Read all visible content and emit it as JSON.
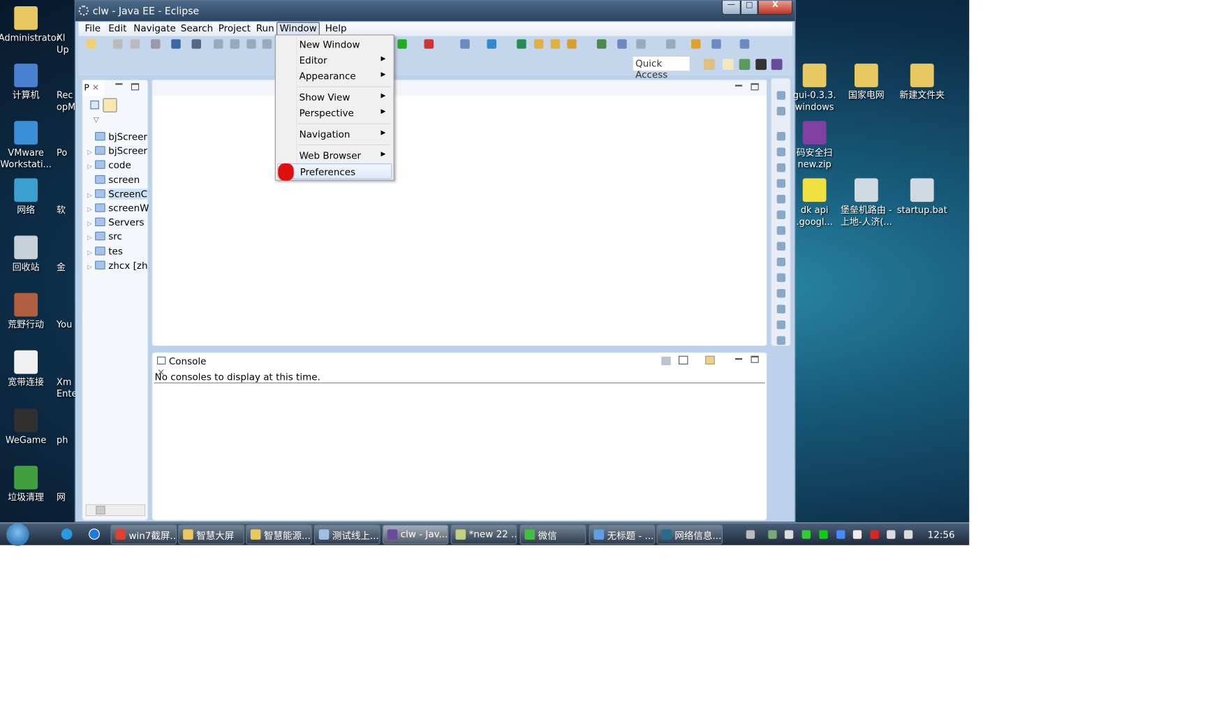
{
  "desktop": {
    "left_icons": [
      {
        "label": "Administrator",
        "color": "#e8c860"
      },
      {
        "label": "计算机",
        "color": "#4a80d0"
      },
      {
        "label": "VMware Workstati...",
        "color": "#3a8fd8"
      },
      {
        "label": "网络",
        "color": "#3aa0d0"
      },
      {
        "label": "回收站",
        "color": "#c8d0d8"
      },
      {
        "label": "荒野行动",
        "color": "#b06040"
      },
      {
        "label": "宽带连接",
        "color": "#f0f0f0"
      },
      {
        "label": "WeGame",
        "color": "#303030"
      },
      {
        "label": "垃圾清理",
        "color": "#40a040"
      }
    ],
    "second_column": [
      "Xl Up",
      "Rec opM",
      "Po",
      "软",
      "金",
      "You",
      "Xm Ente",
      "ph",
      "网"
    ],
    "right_icons": [
      {
        "label": "gui-0.3.3. windows",
        "color": "#e8c860"
      },
      {
        "label": "国家电网",
        "color": "#e8c860"
      },
      {
        "label": "新建文件夹",
        "color": "#e8c860"
      },
      {
        "label": "码安全扫 new.zip",
        "color": "#8040a0"
      },
      {
        "label": "dk api .googl...",
        "color": "#f0e040"
      },
      {
        "label": "堡垒机路由 - 上地-人济(...",
        "color": "#d0d8e0"
      },
      {
        "label": "startup.bat",
        "color": "#d0d8e0"
      }
    ]
  },
  "window": {
    "title": "clw - Java EE - Eclipse",
    "controls": {
      "minimize": "—",
      "maximize": "□",
      "close": "X"
    },
    "menubar": [
      "File",
      "Edit",
      "Navigate",
      "Search",
      "Project",
      "Run",
      "Window",
      "Help"
    ],
    "open_menu": "Window",
    "quick_access": "Quick Access",
    "project_explorer": {
      "tab_label": "P",
      "items": [
        {
          "label": "bjScreer",
          "expandable": false
        },
        {
          "label": "bjScreer",
          "expandable": true
        },
        {
          "label": "code",
          "expandable": true
        },
        {
          "label": "screen",
          "expandable": false
        },
        {
          "label": "ScreenC",
          "expandable": true,
          "selected": true
        },
        {
          "label": "screenW",
          "expandable": true
        },
        {
          "label": "Servers",
          "expandable": true
        },
        {
          "label": "src",
          "expandable": true
        },
        {
          "label": "tes",
          "expandable": true
        },
        {
          "label": "zhcx [zh",
          "expandable": true
        }
      ]
    },
    "console": {
      "tab_label": "Console",
      "message": "No consoles to display at this time."
    }
  },
  "window_menu": {
    "items": [
      {
        "label": "New Window",
        "submenu": false
      },
      {
        "label": "Editor",
        "submenu": true
      },
      {
        "label": "Appearance",
        "submenu": true,
        "sep_after": true
      },
      {
        "label": "Show View",
        "submenu": true
      },
      {
        "label": "Perspective",
        "submenu": true,
        "sep_after": true
      },
      {
        "label": "Navigation",
        "submenu": true,
        "sep_after": true
      },
      {
        "label": "Web Browser",
        "submenu": true
      },
      {
        "label": "Preferences",
        "submenu": false,
        "highlighted": true
      }
    ]
  },
  "taskbar": {
    "buttons": [
      {
        "label": "win7截屏...",
        "color": "#e04030"
      },
      {
        "label": "智慧大屏",
        "color": "#e8c860"
      },
      {
        "label": "智慧能源...",
        "color": "#e8c860"
      },
      {
        "label": "测试线上...",
        "color": "#a0c0e0"
      },
      {
        "label": "clw - Jav...",
        "color": "#6a4a9a",
        "active": true
      },
      {
        "label": "*new 22 ...",
        "color": "#c0d080"
      },
      {
        "label": "微信",
        "color": "#40c040"
      },
      {
        "label": "无标题 - ...",
        "color": "#60a0e0"
      },
      {
        "label": "网络信息...",
        "color": "#2a6a8a"
      }
    ],
    "clock": "12:56"
  }
}
